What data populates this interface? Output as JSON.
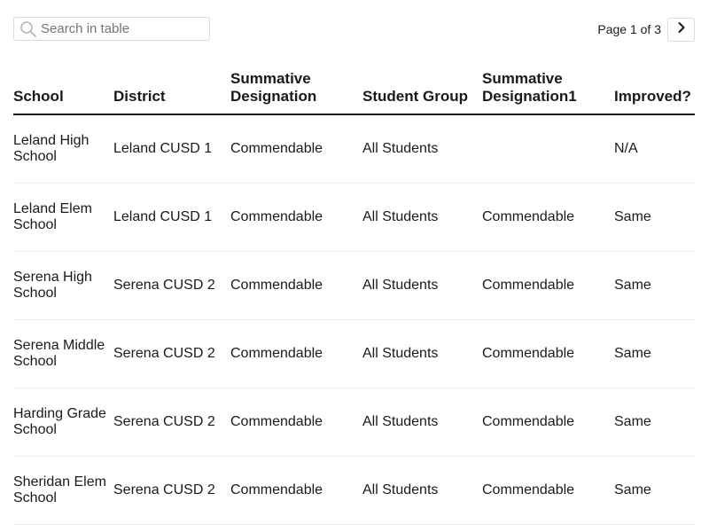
{
  "search": {
    "placeholder": "Search in table"
  },
  "pager": {
    "label": "Page 1 of 3"
  },
  "table": {
    "headers": [
      "School",
      "District",
      "Summative Designation",
      "Student Group",
      "Summative Designation1",
      "Improved?"
    ],
    "rows": [
      [
        "Leland High School",
        "Leland CUSD 1",
        "Commendable",
        "All Students",
        "",
        "N/A"
      ],
      [
        "Leland Elem School",
        "Leland CUSD 1",
        "Commendable",
        "All Students",
        "Commendable",
        "Same"
      ],
      [
        "Serena High School",
        "Serena CUSD 2",
        "Commendable",
        "All Students",
        "Commendable",
        "Same"
      ],
      [
        "Serena Middle School",
        "Serena CUSD 2",
        "Commendable",
        "All Students",
        "Commendable",
        "Same"
      ],
      [
        "Harding Grade School",
        "Serena CUSD 2",
        "Commendable",
        "All Students",
        "Commendable",
        "Same"
      ],
      [
        "Sheridan Elem School",
        "Serena CUSD 2",
        "Commendable",
        "All Students",
        "Commendable",
        "Same"
      ]
    ]
  },
  "icons": {
    "search": "search-icon",
    "next": "chevron-right-icon"
  }
}
